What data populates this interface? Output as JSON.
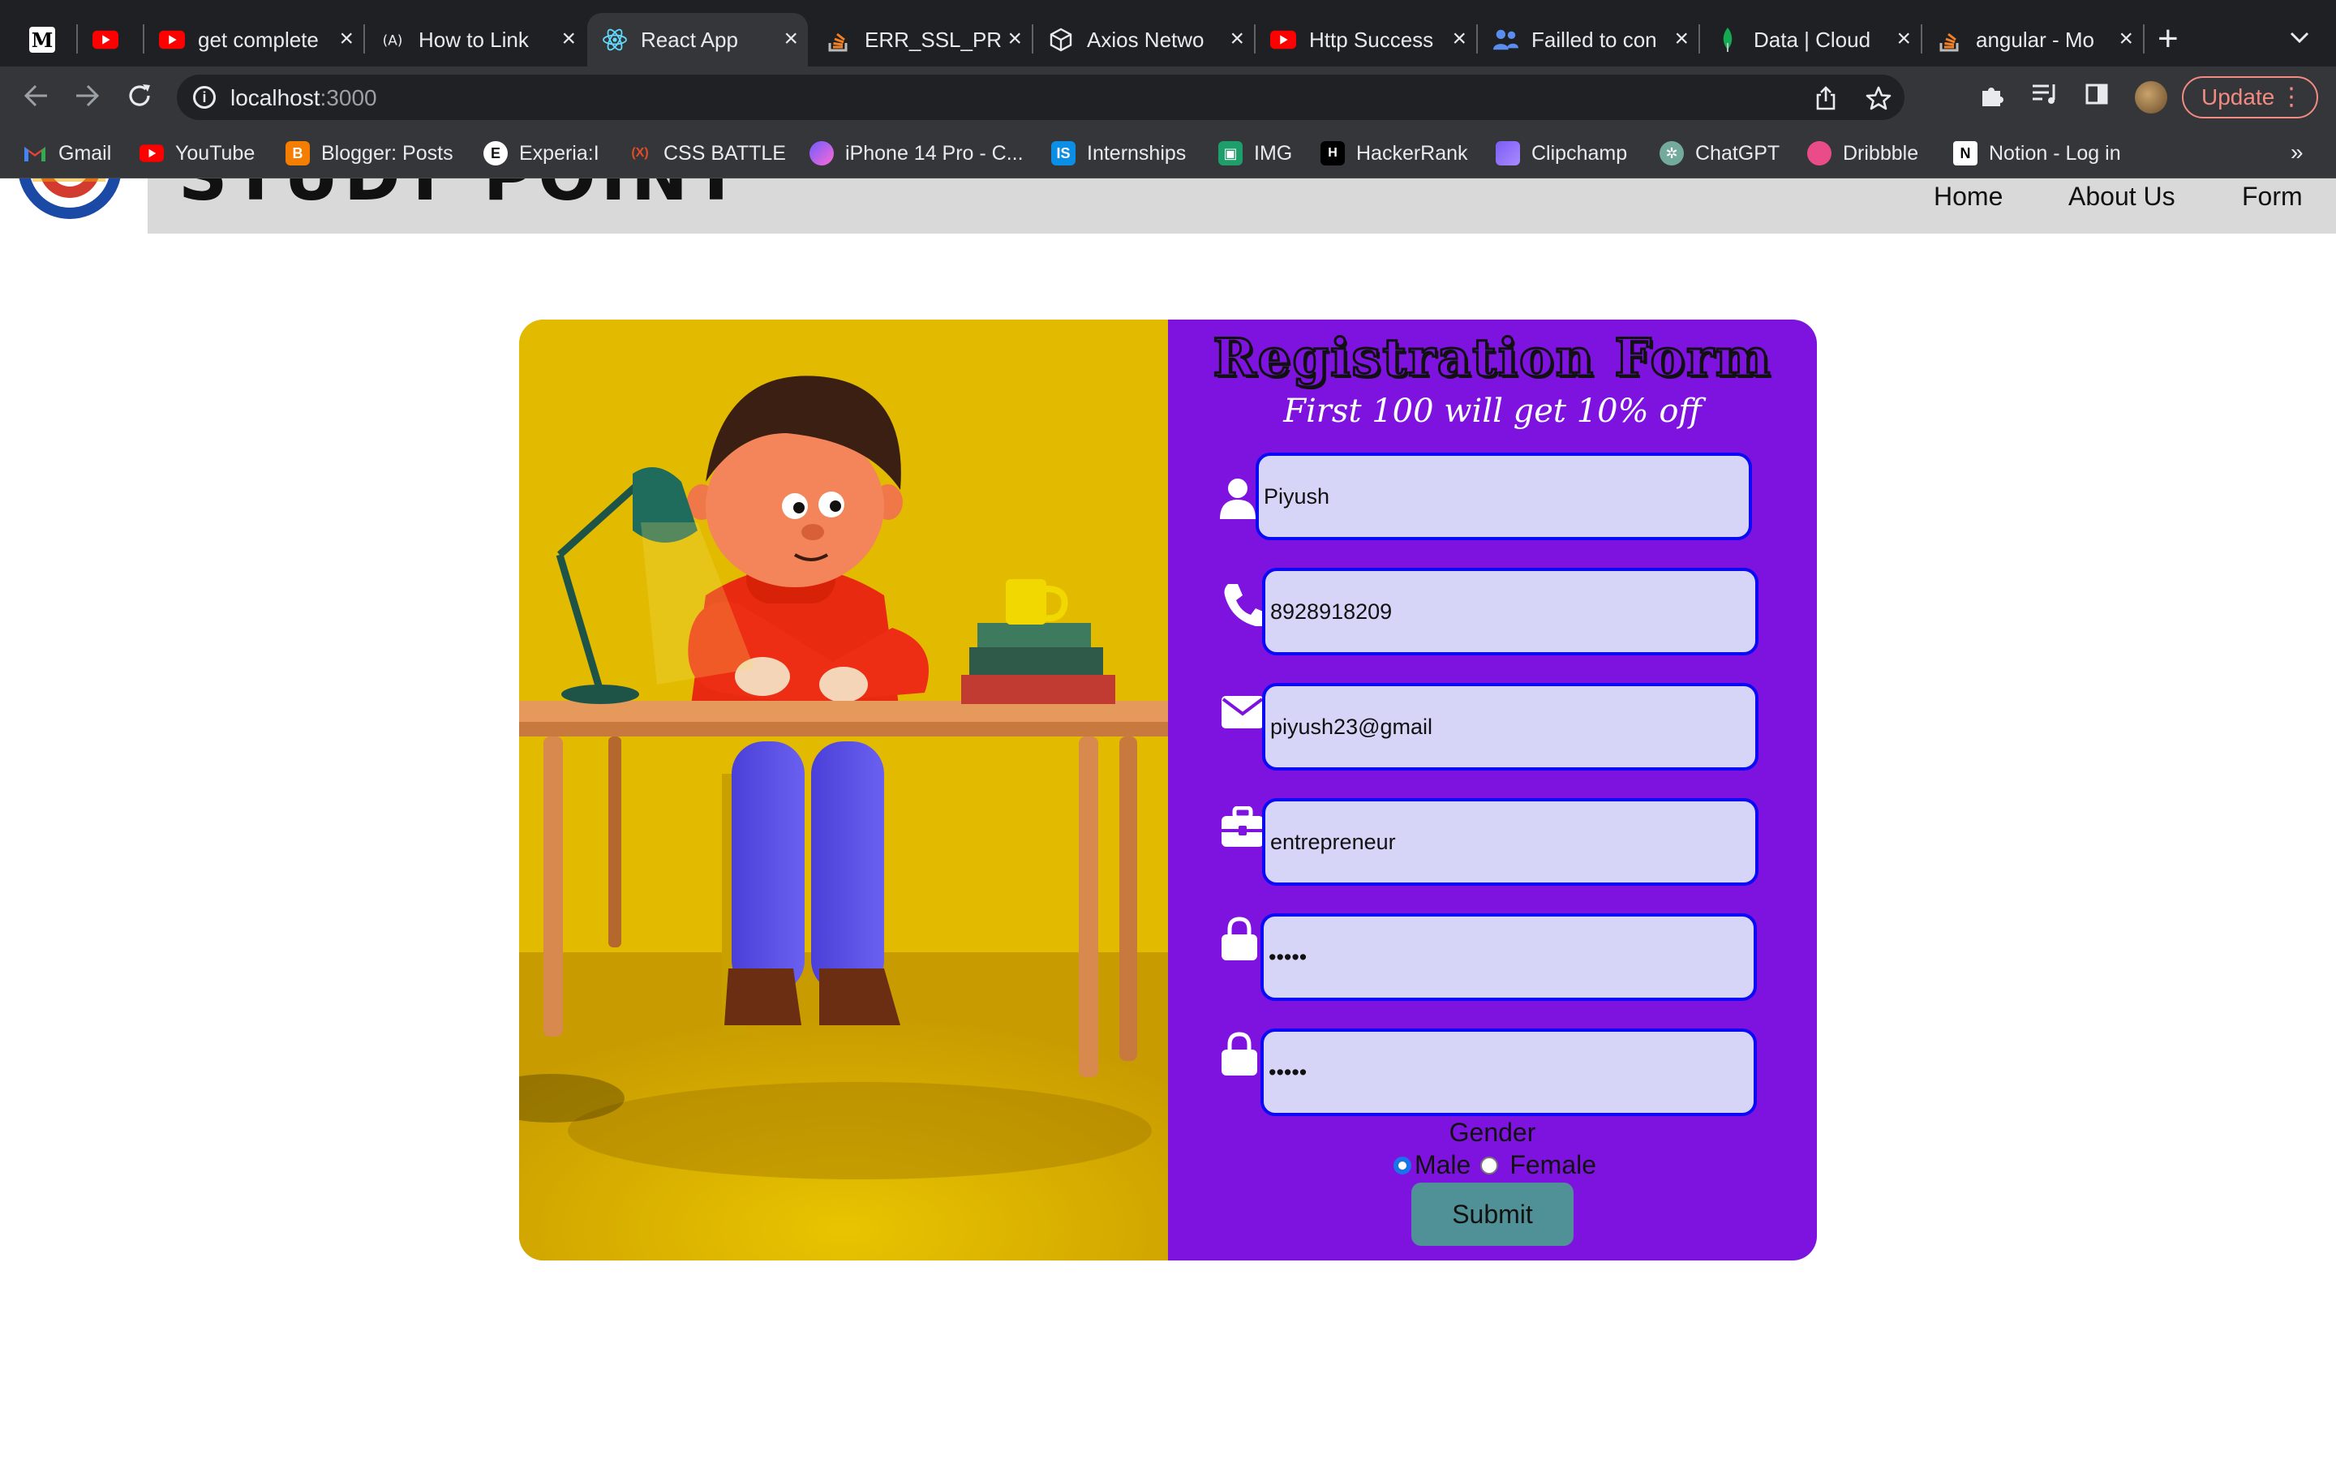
{
  "browser": {
    "tabs": [
      {
        "title": "",
        "icon": "medium-icon"
      },
      {
        "title": "",
        "icon": "youtube-icon"
      },
      {
        "title": "get complete",
        "icon": "youtube-icon"
      },
      {
        "title": "How to Link",
        "icon": "angular-icon"
      },
      {
        "title": "React App",
        "icon": "react-icon"
      },
      {
        "title": "ERR_SSL_PR",
        "icon": "stackoverflow-icon"
      },
      {
        "title": "Axios Netwo",
        "icon": "codesandbox-icon"
      },
      {
        "title": "Http Success",
        "icon": "youtube-icon"
      },
      {
        "title": "Failled to con",
        "icon": "teams-icon"
      },
      {
        "title": "Data | Cloud",
        "icon": "mongodb-icon"
      },
      {
        "title": "angular - Mo",
        "icon": "stackoverflow-icon"
      }
    ],
    "address": {
      "host": "localhost",
      "port": ":3000"
    },
    "update_label": "Update",
    "bookmarks": [
      {
        "label": "Gmail",
        "icon": "gmail-icon"
      },
      {
        "label": "YouTube",
        "icon": "youtube-icon"
      },
      {
        "label": "Blogger: Posts",
        "icon": "blogger-icon"
      },
      {
        "label": "Experia:I",
        "icon": "experia-icon"
      },
      {
        "label": "CSS BATTLE",
        "icon": "cssbattle-icon"
      },
      {
        "label": "iPhone 14 Pro - C...",
        "icon": "iphone-icon"
      },
      {
        "label": "Internships",
        "icon": "internshala-icon"
      },
      {
        "label": "IMG",
        "icon": "image-icon"
      },
      {
        "label": "HackerRank",
        "icon": "hackerrank-icon"
      },
      {
        "label": "Clipchamp",
        "icon": "clipchamp-icon"
      },
      {
        "label": "ChatGPT",
        "icon": "chatgpt-icon"
      },
      {
        "label": "Dribbble",
        "icon": "dribbble-icon"
      },
      {
        "label": "Notion - Log in",
        "icon": "notion-icon"
      }
    ]
  },
  "site": {
    "brand": "STUDY POINT",
    "nav": {
      "home": "Home",
      "about": "About Us",
      "form": "Form"
    }
  },
  "form": {
    "title": "Registration Form",
    "subtitle": "First 100 will get 10% off",
    "name_value": "Piyush",
    "phone_value": "8928918209",
    "email_value": "piyush23@gmail",
    "profession_value": "entrepreneur",
    "password_value": "•••••",
    "confirm_value": "•••••",
    "gender_label": "Gender",
    "gender_options": {
      "male": "Male",
      "female": "Female"
    },
    "gender_selected": "Male",
    "submit_label": "Submit"
  },
  "colors": {
    "form_panel": "#7e13e0",
    "illustration_bg": "#e2bb00",
    "input_bg": "#d6d5f8",
    "input_border": "#0a0af5",
    "submit_bg": "#4f9197"
  }
}
